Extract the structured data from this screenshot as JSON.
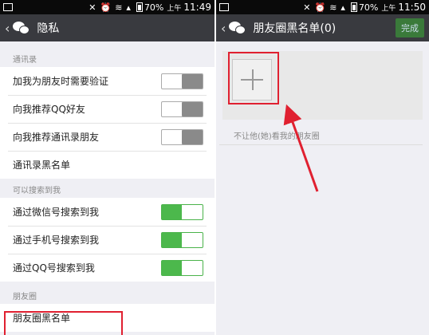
{
  "left": {
    "status": {
      "battery": "70%",
      "ampm": "上午",
      "time": "11:49"
    },
    "title": "隐私",
    "sections": [
      {
        "header": "通讯录",
        "rows": [
          {
            "label": "加我为朋友时需要验证",
            "toggle": "off"
          },
          {
            "label": "向我推荐QQ好友",
            "toggle": "off"
          },
          {
            "label": "向我推荐通讯录朋友",
            "toggle": "off"
          },
          {
            "label": "通讯录黑名单",
            "toggle": null
          }
        ]
      },
      {
        "header": "可以搜索到我",
        "rows": [
          {
            "label": "通过微信号搜索到我",
            "toggle": "on"
          },
          {
            "label": "通过手机号搜索到我",
            "toggle": "on"
          },
          {
            "label": "通过QQ号搜索到我",
            "toggle": "on"
          }
        ]
      },
      {
        "header": "朋友圈",
        "rows": [
          {
            "label": "朋友圈黑名单",
            "toggle": null
          }
        ]
      }
    ]
  },
  "right": {
    "status": {
      "battery": "70%",
      "ampm": "上午",
      "time": "11:50"
    },
    "title": "朋友圈黑名单(0)",
    "done_label": "完成",
    "hint": "不让他(她)看我的朋友圈"
  },
  "colors": {
    "annotation": "#e02030",
    "toggle_on": "#4cb84c",
    "titlebar": "#393a3f"
  }
}
